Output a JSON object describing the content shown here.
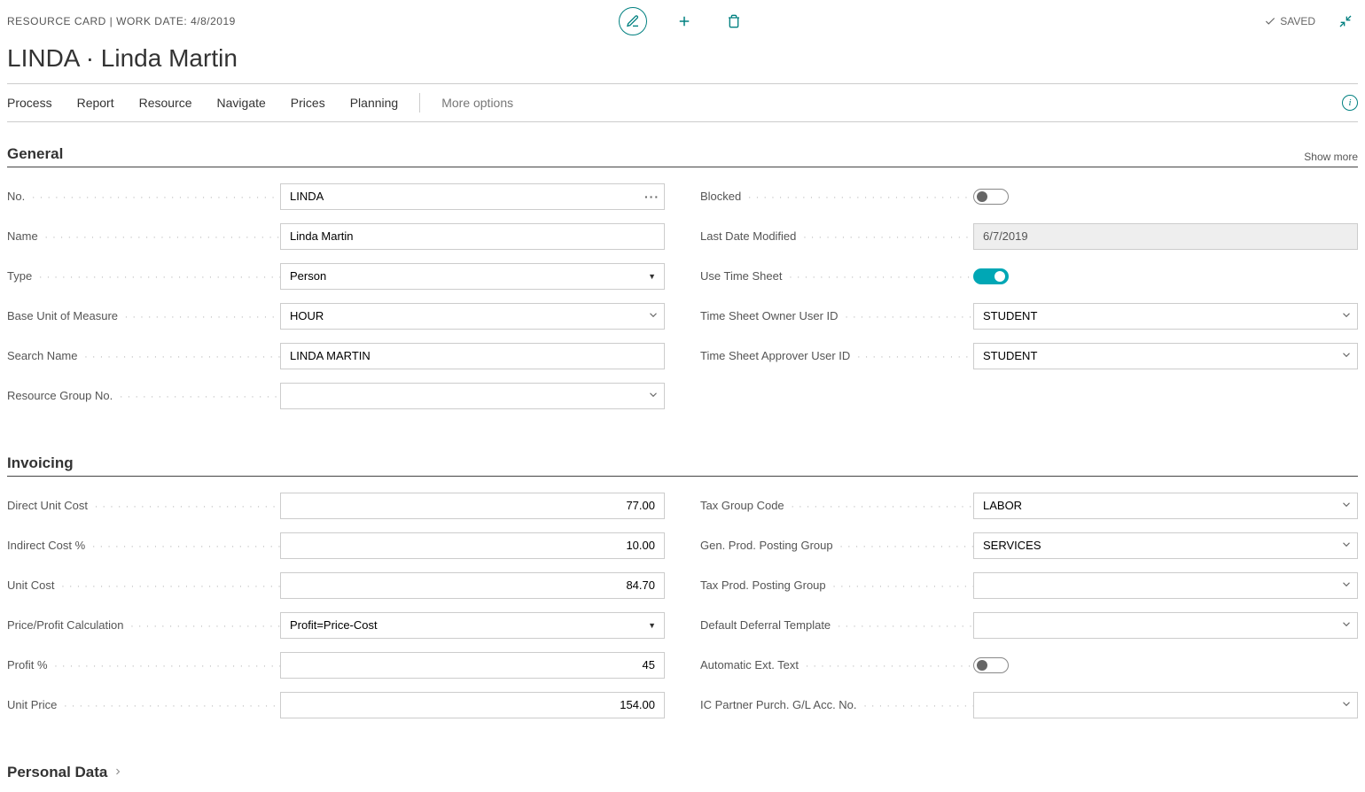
{
  "header": {
    "breadcrumb": "RESOURCE CARD | WORK DATE: 4/8/2019",
    "saved_label": "SAVED"
  },
  "title": "LINDA · Linda Martin",
  "menu": {
    "items": [
      "Process",
      "Report",
      "Resource",
      "Navigate",
      "Prices",
      "Planning"
    ],
    "more": "More options"
  },
  "sections": {
    "general": {
      "title": "General",
      "show_more": "Show more",
      "left": [
        {
          "label": "No.",
          "value": "LINDA",
          "type": "lookup-dots"
        },
        {
          "label": "Name",
          "value": "Linda Martin",
          "type": "text"
        },
        {
          "label": "Type",
          "value": "Person",
          "type": "select"
        },
        {
          "label": "Base Unit of Measure",
          "value": "HOUR",
          "type": "lookup"
        },
        {
          "label": "Search Name",
          "value": "LINDA MARTIN",
          "type": "text"
        },
        {
          "label": "Resource Group No.",
          "value": "",
          "type": "lookup"
        }
      ],
      "right": [
        {
          "label": "Blocked",
          "value": "off",
          "type": "toggle"
        },
        {
          "label": "Last Date Modified",
          "value": "6/7/2019",
          "type": "readonly"
        },
        {
          "label": "Use Time Sheet",
          "value": "on",
          "type": "toggle"
        },
        {
          "label": "Time Sheet Owner User ID",
          "value": "STUDENT",
          "type": "lookup"
        },
        {
          "label": "Time Sheet Approver User ID",
          "value": "STUDENT",
          "type": "lookup"
        }
      ]
    },
    "invoicing": {
      "title": "Invoicing",
      "left": [
        {
          "label": "Direct Unit Cost",
          "value": "77.00",
          "type": "number"
        },
        {
          "label": "Indirect Cost %",
          "value": "10.00",
          "type": "number"
        },
        {
          "label": "Unit Cost",
          "value": "84.70",
          "type": "number"
        },
        {
          "label": "Price/Profit Calculation",
          "value": "Profit=Price-Cost",
          "type": "select"
        },
        {
          "label": "Profit %",
          "value": "45",
          "type": "number"
        },
        {
          "label": "Unit Price",
          "value": "154.00",
          "type": "number"
        }
      ],
      "right": [
        {
          "label": "Tax Group Code",
          "value": "LABOR",
          "type": "lookup"
        },
        {
          "label": "Gen. Prod. Posting Group",
          "value": "SERVICES",
          "type": "lookup"
        },
        {
          "label": "Tax Prod. Posting Group",
          "value": "",
          "type": "lookup"
        },
        {
          "label": "Default Deferral Template",
          "value": "",
          "type": "lookup"
        },
        {
          "label": "Automatic Ext. Text",
          "value": "off",
          "type": "toggle"
        },
        {
          "label": "IC Partner Purch. G/L Acc. No.",
          "value": "",
          "type": "lookup"
        }
      ]
    },
    "personal": {
      "title": "Personal Data"
    }
  }
}
